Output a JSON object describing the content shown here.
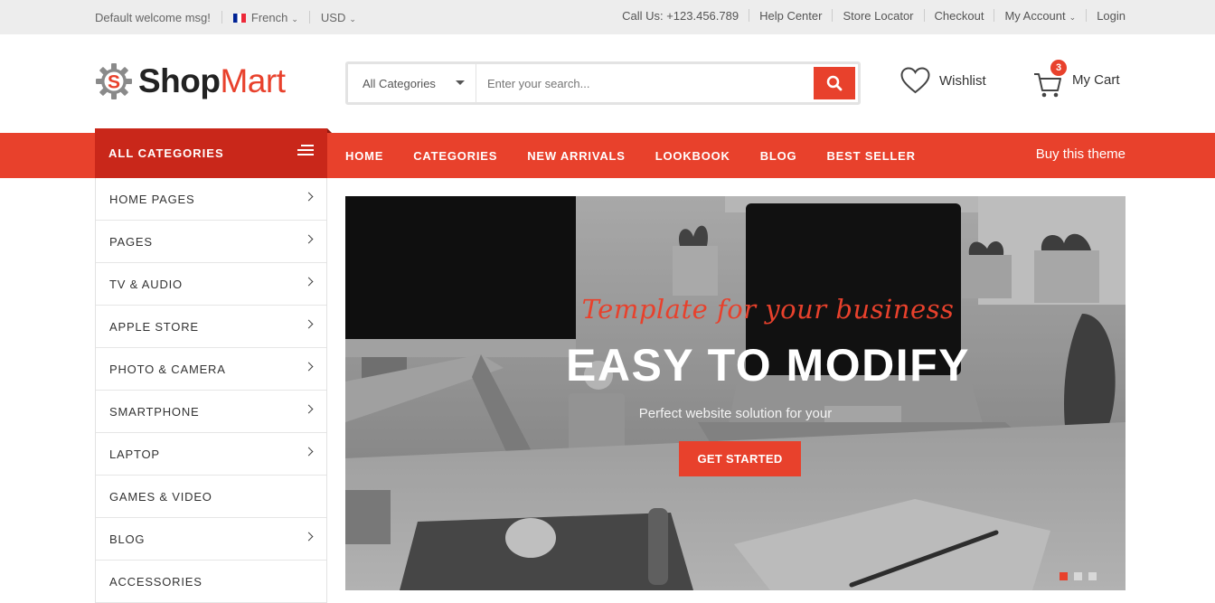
{
  "topbar": {
    "welcome": "Default welcome msg!",
    "language": "French",
    "currency": "USD",
    "call_us": "Call Us: +123.456.789",
    "links": [
      "Help Center",
      "Store Locator",
      "Checkout",
      "My Account",
      "Login"
    ]
  },
  "brand": {
    "name_shop": "Shop",
    "name_mart": "Mart",
    "accent": "#e8412c"
  },
  "search": {
    "category": "All Categories",
    "placeholder": "Enter your search...",
    "button_icon": "search-icon"
  },
  "wishlist": {
    "label": "Wishlist",
    "icon": "heart-icon"
  },
  "cart": {
    "label": "My Cart",
    "count": "3",
    "icon": "cart-icon"
  },
  "nav": {
    "all_categories": "ALL CATEGORIES",
    "links": [
      "HOME",
      "CATEGORIES",
      "NEW ARRIVALS",
      "LOOKBOOK",
      "BLOG",
      "BEST SELLER"
    ],
    "buy_theme": "Buy this theme"
  },
  "sidebar": {
    "items": [
      {
        "label": "HOME PAGES",
        "has_arrow": true
      },
      {
        "label": "PAGES",
        "has_arrow": true
      },
      {
        "label": "TV & AUDIO",
        "has_arrow": true
      },
      {
        "label": "APPLE STORE",
        "has_arrow": true
      },
      {
        "label": "PHOTO & CAMERA",
        "has_arrow": true
      },
      {
        "label": "SMARTPHONE",
        "has_arrow": true
      },
      {
        "label": "LAPTOP",
        "has_arrow": true
      },
      {
        "label": "GAMES & VIDEO",
        "has_arrow": false
      },
      {
        "label": "BLOG",
        "has_arrow": true
      },
      {
        "label": "ACCESSORIES",
        "has_arrow": false
      }
    ]
  },
  "hero": {
    "script": "Template for your business",
    "headline": "EASY TO MODIFY",
    "sub": "Perfect website solution for your",
    "cta": "GET STARTED",
    "slides": 3,
    "active_slide": 1
  }
}
